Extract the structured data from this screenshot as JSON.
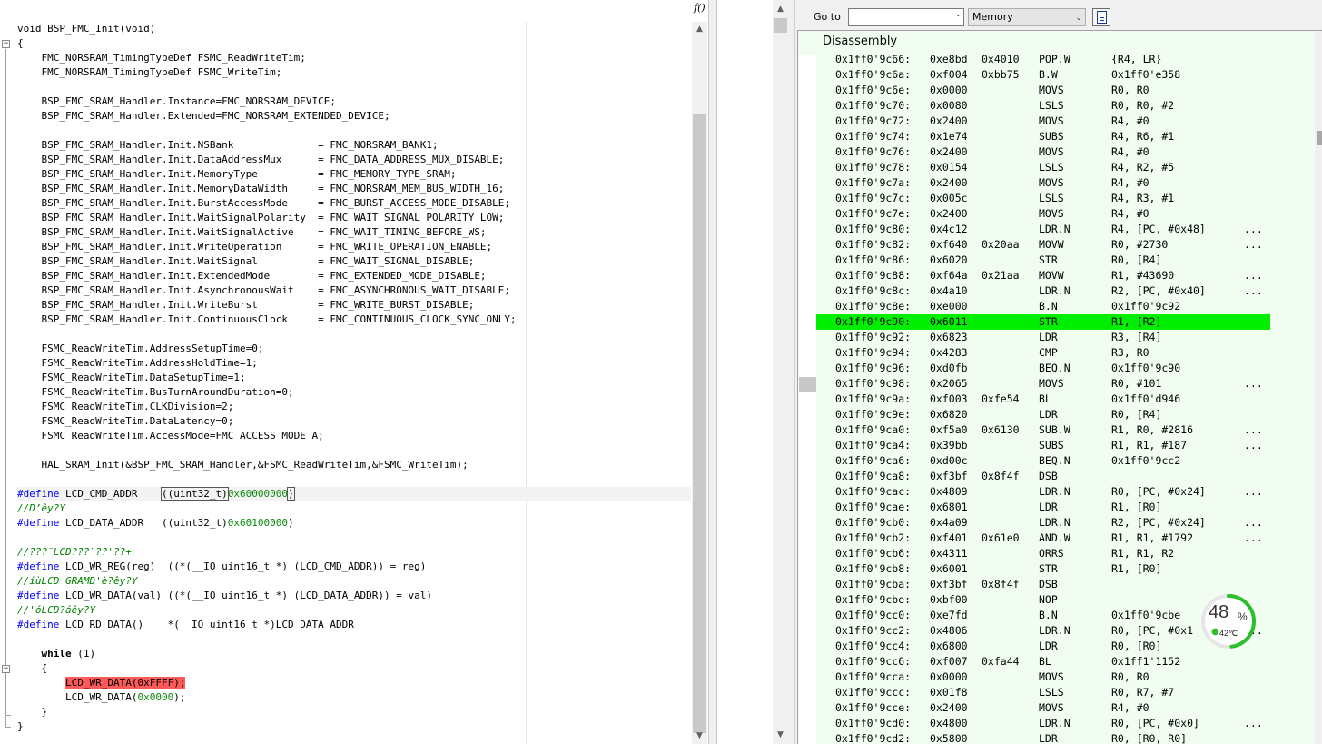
{
  "editor": {
    "function_button": "f()",
    "lines": [
      [
        {
          "t": "void BSP_FMC_Init(void)"
        }
      ],
      [
        {
          "t": "{"
        }
      ],
      [
        {
          "t": "    FMC_NORSRAM_TimingTypeDef FSMC_ReadWriteTim;"
        }
      ],
      [
        {
          "t": "    FMC_NORSRAM_TimingTypeDef FSMC_WriteTim;"
        }
      ],
      [
        {
          "t": ""
        }
      ],
      [
        {
          "t": "    BSP_FMC_SRAM_Handler.Instance=FMC_NORSRAM_DEVICE;"
        }
      ],
      [
        {
          "t": "    BSP_FMC_SRAM_Handler.Extended=FMC_NORSRAM_EXTENDED_DEVICE;"
        }
      ],
      [
        {
          "t": ""
        }
      ],
      [
        {
          "t": "    BSP_FMC_SRAM_Handler.Init.NSBank              = FMC_NORSRAM_BANK1;"
        }
      ],
      [
        {
          "t": "    BSP_FMC_SRAM_Handler.Init.DataAddressMux      = FMC_DATA_ADDRESS_MUX_DISABLE;"
        }
      ],
      [
        {
          "t": "    BSP_FMC_SRAM_Handler.Init.MemoryType          = FMC_MEMORY_TYPE_SRAM;"
        }
      ],
      [
        {
          "t": "    BSP_FMC_SRAM_Handler.Init.MemoryDataWidth     = FMC_NORSRAM_MEM_BUS_WIDTH_16;"
        }
      ],
      [
        {
          "t": "    BSP_FMC_SRAM_Handler.Init.BurstAccessMode     = FMC_BURST_ACCESS_MODE_DISABLE;"
        }
      ],
      [
        {
          "t": "    BSP_FMC_SRAM_Handler.Init.WaitSignalPolarity  = FMC_WAIT_SIGNAL_POLARITY_LOW;"
        }
      ],
      [
        {
          "t": "    BSP_FMC_SRAM_Handler.Init.WaitSignalActive    = FMC_WAIT_TIMING_BEFORE_WS;"
        }
      ],
      [
        {
          "t": "    BSP_FMC_SRAM_Handler.Init.WriteOperation      = FMC_WRITE_OPERATION_ENABLE;"
        }
      ],
      [
        {
          "t": "    BSP_FMC_SRAM_Handler.Init.WaitSignal          = FMC_WAIT_SIGNAL_DISABLE;"
        }
      ],
      [
        {
          "t": "    BSP_FMC_SRAM_Handler.Init.ExtendedMode        = FMC_EXTENDED_MODE_DISABLE;"
        }
      ],
      [
        {
          "t": "    BSP_FMC_SRAM_Handler.Init.AsynchronousWait    = FMC_ASYNCHRONOUS_WAIT_DISABLE;"
        }
      ],
      [
        {
          "t": "    BSP_FMC_SRAM_Handler.Init.WriteBurst          = FMC_WRITE_BURST_DISABLE;"
        }
      ],
      [
        {
          "t": "    BSP_FMC_SRAM_Handler.Init.ContinuousClock     = FMC_CONTINUOUS_CLOCK_SYNC_ONLY;"
        }
      ],
      [
        {
          "t": ""
        }
      ],
      [
        {
          "t": "    FSMC_ReadWriteTim.AddressSetupTime=0;"
        }
      ],
      [
        {
          "t": "    FSMC_ReadWriteTim.AddressHoldTime=1;"
        }
      ],
      [
        {
          "t": "    FSMC_ReadWriteTim.DataSetupTime=1;"
        }
      ],
      [
        {
          "t": "    FSMC_ReadWriteTim.BusTurnAroundDuration=0;"
        }
      ],
      [
        {
          "t": "    FSMC_ReadWriteTim.CLKDivision=2;"
        }
      ],
      [
        {
          "t": "    FSMC_ReadWriteTim.DataLatency=0;"
        }
      ],
      [
        {
          "t": "    FSMC_ReadWriteTim.AccessMode=FMC_ACCESS_MODE_A;"
        }
      ],
      [
        {
          "t": ""
        }
      ],
      [
        {
          "t": "    HAL_SRAM_Init(&BSP_FMC_SRAM_Handler,&FSMC_ReadWriteTim,&FSMC_WriteTim);"
        }
      ],
      [
        {
          "t": ""
        }
      ],
      [
        {
          "t": "#define",
          "k": "kw"
        },
        {
          "t": " LCD_CMD_ADDR    "
        },
        {
          "t": "((uint32_t)",
          "k": "box"
        },
        {
          "t": "0x60000000",
          "k": "num"
        },
        {
          "t": ")",
          "k": "box"
        }
      ],
      [
        {
          "t": "//D’êy?Y",
          "k": "cm"
        }
      ],
      [
        {
          "t": "#define",
          "k": "kw"
        },
        {
          "t": " LCD_DATA_ADDR   ((uint32_t)"
        },
        {
          "t": "0x60100000",
          "k": "num"
        },
        {
          "t": ")"
        }
      ],
      [
        {
          "t": ""
        }
      ],
      [
        {
          "t": "//???¨LCD???¨??'??+",
          "k": "cm"
        }
      ],
      [
        {
          "t": "#define",
          "k": "kw"
        },
        {
          "t": " LCD_WR_REG(reg)  ((*(__IO uint16_t *) (LCD_CMD_ADDR)) = reg)"
        }
      ],
      [
        {
          "t": "//íùLCD GRAMD'è?êy?Y",
          "k": "cm"
        }
      ],
      [
        {
          "t": "#define",
          "k": "kw"
        },
        {
          "t": " LCD_WR_DATA(val) ((*(__IO uint16_t *) (LCD_DATA_ADDR)) = val)"
        }
      ],
      [
        {
          "t": "//'óLCD?áêy?Y",
          "k": "cm"
        }
      ],
      [
        {
          "t": "#define",
          "k": "kw"
        },
        {
          "t": " LCD_RD_DATA()    *(__IO uint16_t *)LCD_DATA_ADDR"
        }
      ],
      [
        {
          "t": ""
        }
      ],
      [
        {
          "t": "    "
        },
        {
          "t": "while",
          "k": "bold"
        },
        {
          "t": " (1)"
        }
      ],
      [
        {
          "t": "    {"
        }
      ],
      [
        {
          "t": "        "
        },
        {
          "t": "LCD_WR_DATA(",
          "k": "hl"
        },
        {
          "t": "0xFFFF",
          "k": "hlnum"
        },
        {
          "t": ");",
          "k": "hl"
        }
      ],
      [
        {
          "t": "        LCD_WR_DATA("
        },
        {
          "t": "0x0000",
          "k": "num"
        },
        {
          "t": ");"
        }
      ],
      [
        {
          "t": "    }"
        }
      ],
      [
        {
          "t": "}"
        }
      ]
    ]
  },
  "toolbar": {
    "goto_label": "Go to",
    "goto_value": "",
    "memory_select": "Memory"
  },
  "disassembly": {
    "title": "Disassembly",
    "current_index": 17,
    "rows": [
      [
        "0x1ff0'9c66:",
        "0xe8bd",
        "0x4010",
        "POP.W",
        "{R4, LR}",
        ""
      ],
      [
        "0x1ff0'9c6a:",
        "0xf004",
        "0xbb75",
        "B.W",
        "0x1ff0'e358",
        ""
      ],
      [
        "0x1ff0'9c6e:",
        "0x0000",
        "",
        "MOVS",
        "R0, R0",
        ""
      ],
      [
        "0x1ff0'9c70:",
        "0x0080",
        "",
        "LSLS",
        "R0, R0, #2",
        ""
      ],
      [
        "0x1ff0'9c72:",
        "0x2400",
        "",
        "MOVS",
        "R4, #0",
        ""
      ],
      [
        "0x1ff0'9c74:",
        "0x1e74",
        "",
        "SUBS",
        "R4, R6, #1",
        ""
      ],
      [
        "0x1ff0'9c76:",
        "0x2400",
        "",
        "MOVS",
        "R4, #0",
        ""
      ],
      [
        "0x1ff0'9c78:",
        "0x0154",
        "",
        "LSLS",
        "R4, R2, #5",
        ""
      ],
      [
        "0x1ff0'9c7a:",
        "0x2400",
        "",
        "MOVS",
        "R4, #0",
        ""
      ],
      [
        "0x1ff0'9c7c:",
        "0x005c",
        "",
        "LSLS",
        "R4, R3, #1",
        ""
      ],
      [
        "0x1ff0'9c7e:",
        "0x2400",
        "",
        "MOVS",
        "R4, #0",
        ""
      ],
      [
        "0x1ff0'9c80:",
        "0x4c12",
        "",
        "LDR.N",
        "R4, [PC, #0x48]",
        "..."
      ],
      [
        "0x1ff0'9c82:",
        "0xf640",
        "0x20aa",
        "MOVW",
        "R0, #2730",
        "..."
      ],
      [
        "0x1ff0'9c86:",
        "0x6020",
        "",
        "STR",
        "R0, [R4]",
        ""
      ],
      [
        "0x1ff0'9c88:",
        "0xf64a",
        "0x21aa",
        "MOVW",
        "R1, #43690",
        "..."
      ],
      [
        "0x1ff0'9c8c:",
        "0x4a10",
        "",
        "LDR.N",
        "R2, [PC, #0x40]",
        "..."
      ],
      [
        "0x1ff0'9c8e:",
        "0xe000",
        "",
        "B.N",
        "0x1ff0'9c92",
        ""
      ],
      [
        "0x1ff0'9c90:",
        "0x6011",
        "",
        "STR",
        "R1, [R2]",
        ""
      ],
      [
        "0x1ff0'9c92:",
        "0x6823",
        "",
        "LDR",
        "R3, [R4]",
        ""
      ],
      [
        "0x1ff0'9c94:",
        "0x4283",
        "",
        "CMP",
        "R3, R0",
        ""
      ],
      [
        "0x1ff0'9c96:",
        "0xd0fb",
        "",
        "BEQ.N",
        "0x1ff0'9c90",
        ""
      ],
      [
        "0x1ff0'9c98:",
        "0x2065",
        "",
        "MOVS",
        "R0, #101",
        "..."
      ],
      [
        "0x1ff0'9c9a:",
        "0xf003",
        "0xfe54",
        "BL",
        "0x1ff0'd946",
        ""
      ],
      [
        "0x1ff0'9c9e:",
        "0x6820",
        "",
        "LDR",
        "R0, [R4]",
        ""
      ],
      [
        "0x1ff0'9ca0:",
        "0xf5a0",
        "0x6130",
        "SUB.W",
        "R1, R0, #2816",
        "..."
      ],
      [
        "0x1ff0'9ca4:",
        "0x39bb",
        "",
        "SUBS",
        "R1, R1, #187",
        "..."
      ],
      [
        "0x1ff0'9ca6:",
        "0xd00c",
        "",
        "BEQ.N",
        "0x1ff0'9cc2",
        ""
      ],
      [
        "0x1ff0'9ca8:",
        "0xf3bf",
        "0x8f4f",
        "DSB",
        "",
        ""
      ],
      [
        "0x1ff0'9cac:",
        "0x4809",
        "",
        "LDR.N",
        "R0, [PC, #0x24]",
        "..."
      ],
      [
        "0x1ff0'9cae:",
        "0x6801",
        "",
        "LDR",
        "R1, [R0]",
        ""
      ],
      [
        "0x1ff0'9cb0:",
        "0x4a09",
        "",
        "LDR.N",
        "R2, [PC, #0x24]",
        "..."
      ],
      [
        "0x1ff0'9cb2:",
        "0xf401",
        "0x61e0",
        "AND.W",
        "R1, R1, #1792",
        "..."
      ],
      [
        "0x1ff0'9cb6:",
        "0x4311",
        "",
        "ORRS",
        "R1, R1, R2",
        ""
      ],
      [
        "0x1ff0'9cb8:",
        "0x6001",
        "",
        "STR",
        "R1, [R0]",
        ""
      ],
      [
        "0x1ff0'9cba:",
        "0xf3bf",
        "0x8f4f",
        "DSB",
        "",
        ""
      ],
      [
        "0x1ff0'9cbe:",
        "0xbf00",
        "",
        "NOP",
        "",
        ""
      ],
      [
        "0x1ff0'9cc0:",
        "0xe7fd",
        "",
        "B.N",
        "0x1ff0'9cbe",
        ""
      ],
      [
        "0x1ff0'9cc2:",
        "0x4806",
        "",
        "LDR.N",
        "R0, [PC, #0x1",
        "..."
      ],
      [
        "0x1ff0'9cc4:",
        "0x6800",
        "",
        "LDR",
        "R0, [R0]",
        ""
      ],
      [
        "0x1ff0'9cc6:",
        "0xf007",
        "0xfa44",
        "BL",
        "0x1ff1'1152",
        ""
      ],
      [
        "0x1ff0'9cca:",
        "0x0000",
        "",
        "MOVS",
        "R0, R0",
        ""
      ],
      [
        "0x1ff0'9ccc:",
        "0x01f8",
        "",
        "LSLS",
        "R0, R7, #7",
        ""
      ],
      [
        "0x1ff0'9cce:",
        "0x2400",
        "",
        "MOVS",
        "R4, #0",
        ""
      ],
      [
        "0x1ff0'9cd0:",
        "0x4800",
        "",
        "LDR.N",
        "R0, [PC, #0x0]",
        "..."
      ],
      [
        "0x1ff0'9cd2:",
        "0x5800",
        "",
        "LDR",
        "R0, [R0, R0]",
        ""
      ]
    ]
  },
  "temperature_widget": {
    "percent": "48",
    "percent_sign": "%",
    "temperature": "42℃",
    "ring_fraction": 0.48,
    "ring_color": "#2bbf2b",
    "track_color": "#e6e6e6"
  },
  "colors": {
    "current_line": "#00ee00",
    "disassembly_bg": "#f2fdf2",
    "breakpoint_highlight": "#ff5a5a",
    "keyword": "#0000ff",
    "comment": "#008000",
    "number": "#0a8a0a"
  }
}
